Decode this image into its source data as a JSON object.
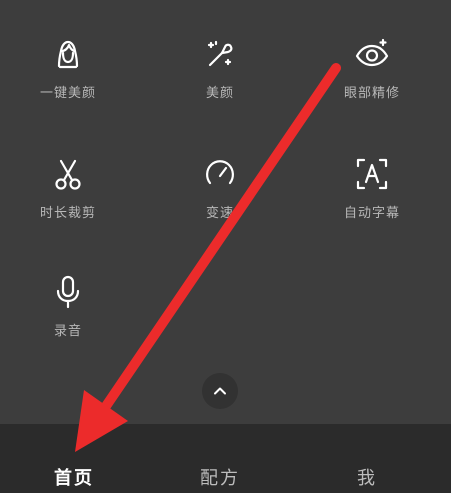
{
  "tools": [
    {
      "id": "one-tap-beauty",
      "label": "一键美颜",
      "icon": "face-icon"
    },
    {
      "id": "beauty",
      "label": "美颜",
      "icon": "magic-wand-icon"
    },
    {
      "id": "eye-refine",
      "label": "眼部精修",
      "icon": "eye-sparkle-icon"
    },
    {
      "id": "trim-duration",
      "label": "时长裁剪",
      "icon": "scissors-icon"
    },
    {
      "id": "speed",
      "label": "变速",
      "icon": "speedometer-icon"
    },
    {
      "id": "auto-subtitles",
      "label": "自动字幕",
      "icon": "subtitle-frame-icon"
    },
    {
      "id": "record-audio",
      "label": "录音",
      "icon": "microphone-icon"
    }
  ],
  "collapse_icon": "chevron-up-icon",
  "nav": {
    "home": "首页",
    "recipes": "配方",
    "me": "我",
    "active": "home"
  },
  "colors": {
    "panel_bg": "#3d3d3d",
    "nav_bg": "#2b2b2b",
    "label": "#b8b8b8",
    "icon": "#ffffff",
    "annotation_arrow": "#ec2b2b"
  }
}
